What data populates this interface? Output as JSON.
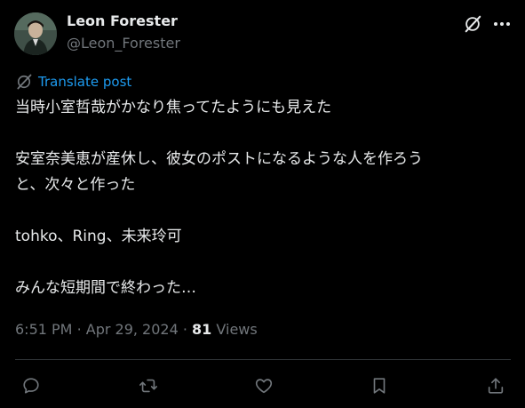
{
  "author": {
    "display_name": "Leon Forester",
    "handle": "@Leon_Forester"
  },
  "icons": {
    "grok": "grok-icon",
    "more": "more-icon",
    "translate": "grok-icon",
    "reply": "reply-icon",
    "repost": "repost-icon",
    "like": "like-icon",
    "bookmark": "bookmark-icon",
    "share": "share-icon"
  },
  "translate_label": "Translate post",
  "post_text": {
    "line1": "当時小室哲哉がかなり焦ってたようにも見えた",
    "line2": "安室奈美恵が産休し、彼女のポストになるような人を作ろう",
    "line3": "と、次々と作った",
    "line4": "tohko、Ring、未来玲可",
    "line5": "みんな短期間で終わった…"
  },
  "meta": {
    "time": "6:51 PM",
    "date": "Apr 29, 2024",
    "separator": "·",
    "views_count": "81",
    "views_label": "Views"
  },
  "colors": {
    "background": "#000000",
    "text": "#e7e9ea",
    "secondary": "#71767b",
    "accent": "#1d9bf0",
    "divider": "#2f3336"
  }
}
